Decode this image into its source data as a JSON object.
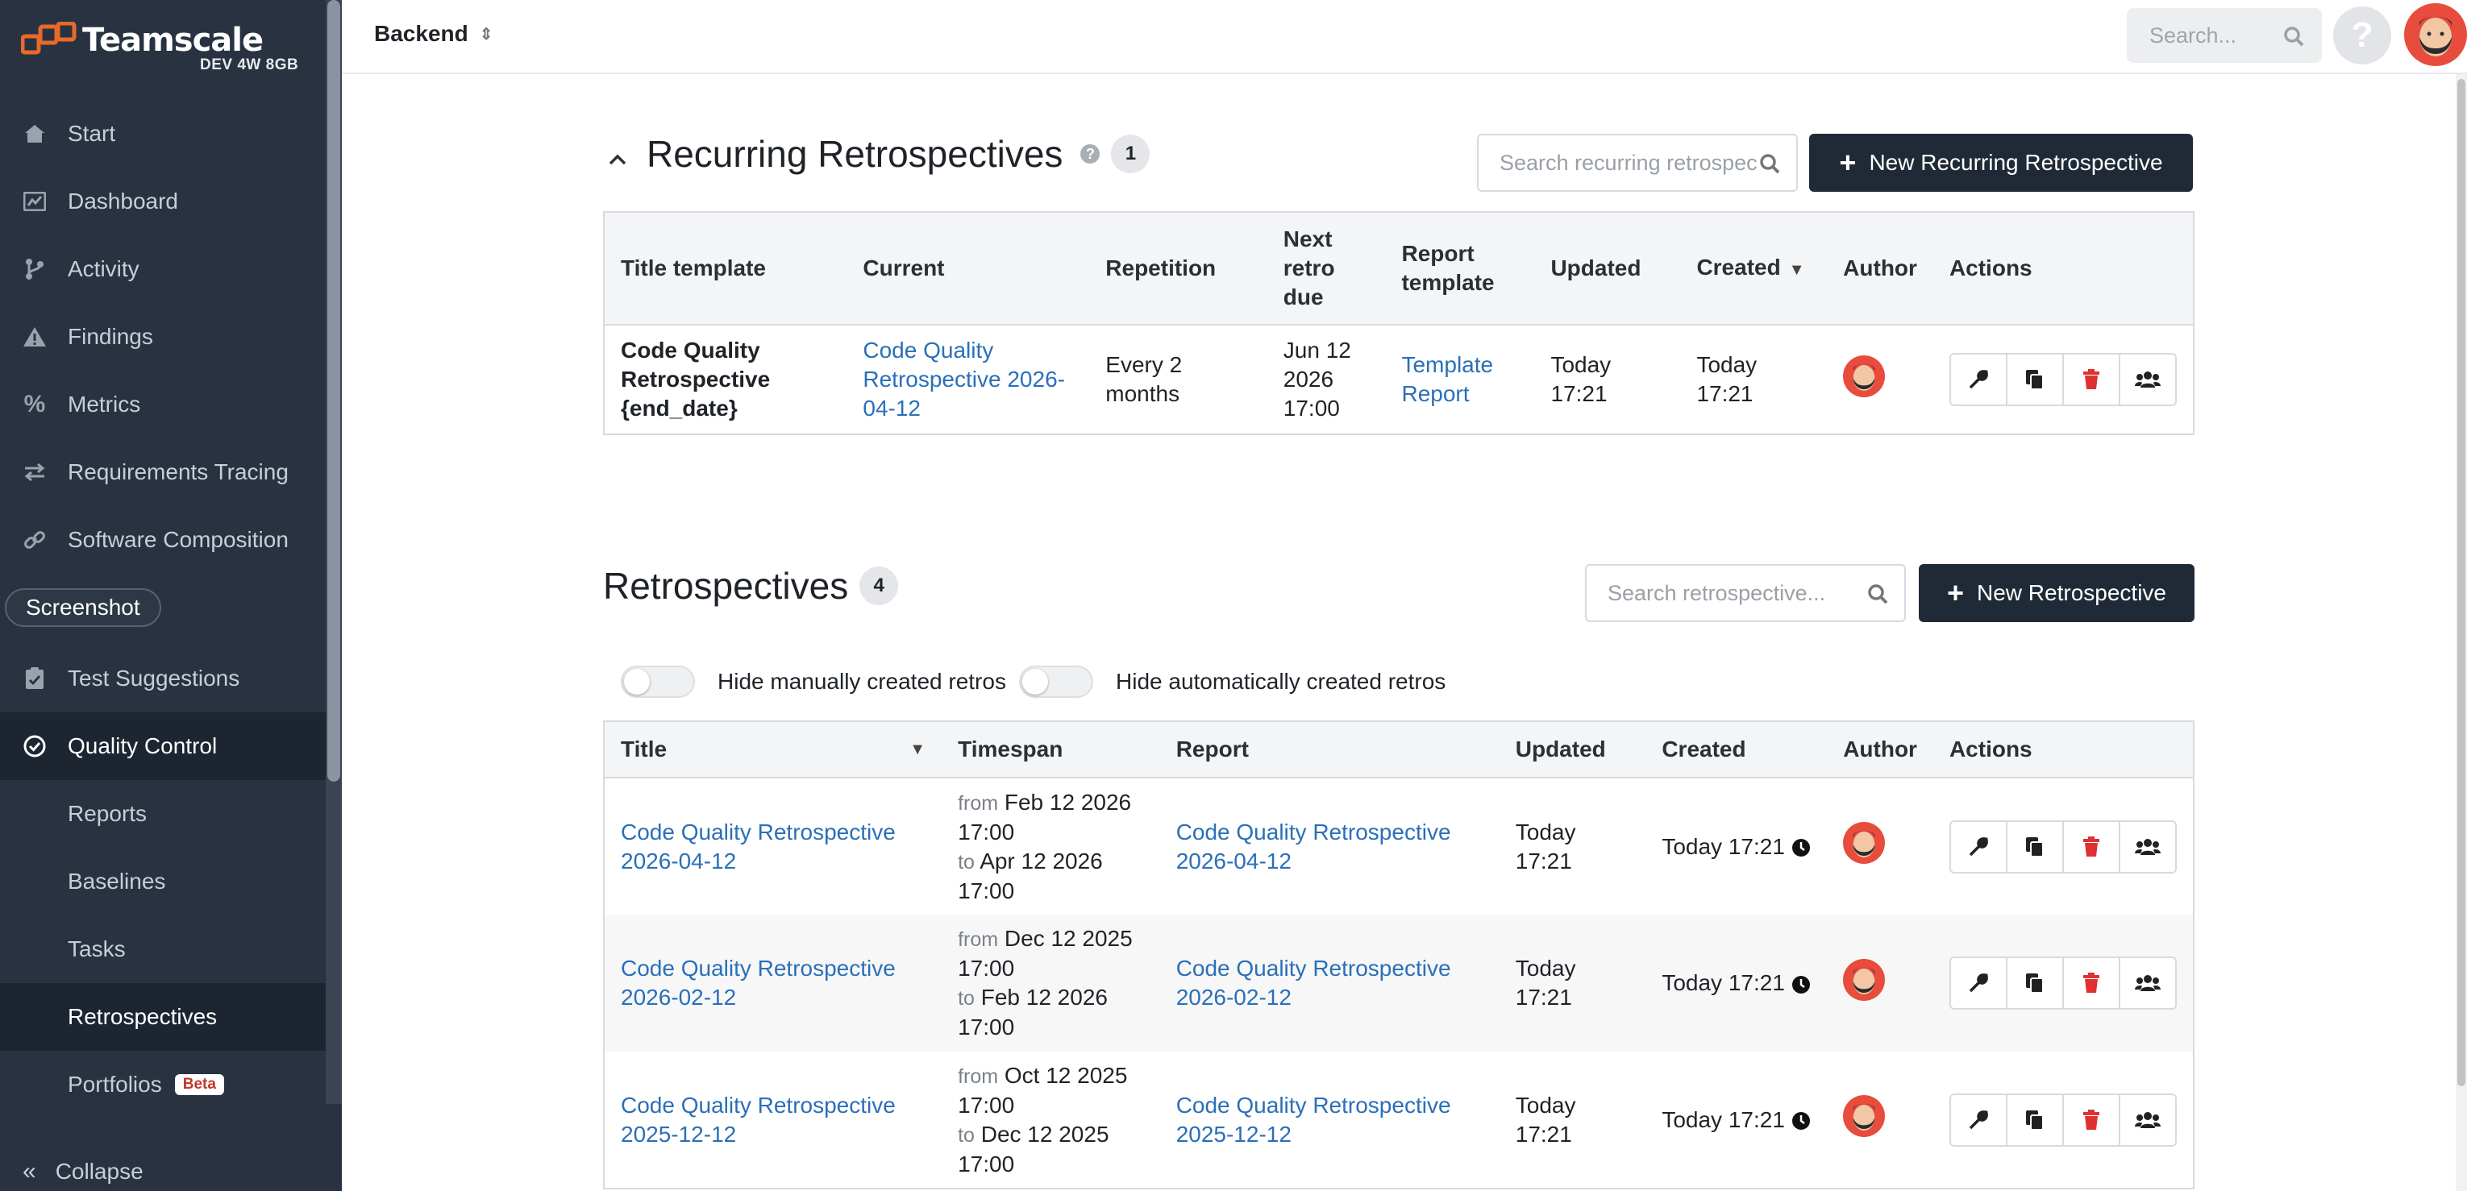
{
  "brand": {
    "name": "Teamscale",
    "subtitle": "DEV 4W 8GB",
    "color_orange": "#e8692a"
  },
  "sidebar": {
    "items": [
      {
        "label": "Start",
        "icon": "home-icon"
      },
      {
        "label": "Dashboard",
        "icon": "dashboard-icon"
      },
      {
        "label": "Activity",
        "icon": "branch-icon"
      },
      {
        "label": "Findings",
        "icon": "warning-icon"
      },
      {
        "label": "Metrics",
        "icon": "percent-icon"
      },
      {
        "label": "Requirements Tracing",
        "icon": "arrows-icon"
      },
      {
        "label": "Software Composition",
        "icon": "link-icon"
      },
      {
        "label": "Test Suggestions",
        "icon": "clipboard-check-icon"
      },
      {
        "label": "Quality Control",
        "icon": "check-circle-icon"
      }
    ],
    "sub_items": [
      "Reports",
      "Baselines",
      "Tasks",
      "Retrospectives",
      "Portfolios"
    ],
    "beta_label": "Beta",
    "screenshot_pill": "Screenshot",
    "collapse_label": "Collapse"
  },
  "topbar": {
    "project": "Backend",
    "search_placeholder": "Search..."
  },
  "recurring": {
    "title": "Recurring Retrospectives",
    "count": "1",
    "search_placeholder": "Search recurring retrospectives...",
    "new_button": "New Recurring Retrospective",
    "headers": [
      "Title template",
      "Current",
      "Repetition",
      "Next retro due",
      "Report template",
      "Updated",
      "Created",
      "Author",
      "Actions"
    ],
    "rows": [
      {
        "title": "Code Quality Retrospective {end_date}",
        "current": "Code Quality Retrospective 2026-04-12",
        "repetition": "Every 2 months",
        "next_due": "Jun 12 2026 17:00",
        "report_template": "Template Report",
        "updated": "Today 17:21",
        "created": "Today 17:21"
      }
    ]
  },
  "retros": {
    "title": "Retrospectives",
    "count": "4",
    "search_placeholder": "Search retrospective...",
    "new_button": "New Retrospective",
    "toggle_manual": "Hide manually created retros",
    "toggle_auto": "Hide automatically created retros",
    "headers": [
      "Title",
      "Timespan",
      "Report",
      "Updated",
      "Created",
      "Author",
      "Actions"
    ],
    "from_label": "from",
    "to_label": "to",
    "rows": [
      {
        "title": "Code Quality Retrospective 2026-04-12",
        "from": "Feb 12 2026 17:00",
        "to": "Apr 12 2026 17:00",
        "report": "Code Quality Retrospective 2026-04-12",
        "updated": "Today 17:21",
        "created": "Today 17:21"
      },
      {
        "title": "Code Quality Retrospective 2026-02-12",
        "from": "Dec 12 2025 17:00",
        "to": "Feb 12 2026 17:00",
        "report": "Code Quality Retrospective 2026-02-12",
        "updated": "Today 17:21",
        "created": "Today 17:21"
      },
      {
        "title": "Code Quality Retrospective 2025-12-12",
        "from": "Oct 12 2025 17:00",
        "to": "Dec 12 2025 17:00",
        "report": "Code Quality Retrospective 2025-12-12",
        "updated": "Today 17:21",
        "created": "Today 17:21"
      }
    ]
  },
  "colors": {
    "link": "#2a6fb8",
    "delete": "#e03131",
    "dark_button": "#202a37"
  }
}
